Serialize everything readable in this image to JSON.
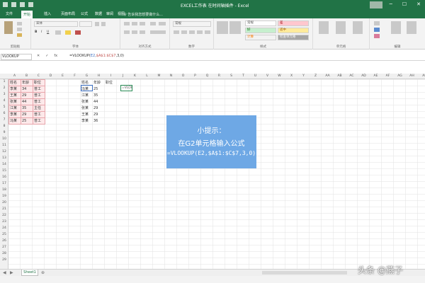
{
  "window": {
    "title": "EXCEL工作表 在时间轴插件 - Excel"
  },
  "tabs": [
    "文件",
    "开始",
    "插入",
    "页面布局",
    "公式",
    "数据",
    "审阅",
    "视图"
  ],
  "tell_me": "♀ 告诉我您想要做什么...",
  "ribbon": {
    "groups": [
      "剪贴板",
      "字体",
      "对齐方式",
      "数字",
      "样式",
      "单元格",
      "编辑"
    ],
    "font_name": "宋体",
    "number_format": "常规",
    "styles": [
      "常规",
      "差",
      "好",
      "适中",
      "计算",
      "检查单元格"
    ]
  },
  "formula_bar": {
    "name_box": "VLOOKUP",
    "buttons": [
      "✕",
      "✓",
      "fx"
    ],
    "prefix": "=VLOOKUP(",
    "ref1": "E2",
    "sep": ",",
    "ref2": "$A$1:$C$7",
    "suffix": ",3,0)"
  },
  "columns": [
    "A",
    "B",
    "C",
    "D",
    "E",
    "F",
    "G",
    "H",
    "I",
    "J",
    "K",
    "L",
    "M",
    "N",
    "O",
    "P",
    "Q",
    "R",
    "S",
    "T",
    "U",
    "V",
    "W",
    "X",
    "Y",
    "Z",
    "AA",
    "AB",
    "AC",
    "AD",
    "AE",
    "AF",
    "AG",
    "AH",
    "AI"
  ],
  "rows": [
    "1",
    "2",
    "3",
    "4",
    "5",
    "6",
    "7",
    "8",
    "9",
    "10",
    "11",
    "12",
    "13",
    "14",
    "15",
    "16",
    "17",
    "18",
    "19",
    "20",
    "21",
    "22",
    "23",
    "24",
    "25",
    "26",
    "27",
    "28",
    "29"
  ],
  "table1": [
    [
      "姓名",
      "年龄",
      "职位"
    ],
    [
      "李某",
      "34",
      "普工"
    ],
    [
      "王某",
      "29",
      "普工"
    ],
    [
      "张某",
      "44",
      "普工"
    ],
    [
      "江某",
      "35",
      "主任"
    ],
    [
      "李某",
      "29",
      "普工"
    ],
    [
      "冯某",
      "25",
      "普工"
    ]
  ],
  "table2": [
    [
      "姓名",
      "年龄",
      "职位"
    ],
    [
      "冯某",
      "25",
      ""
    ],
    [
      "江某",
      "35",
      ""
    ],
    [
      "张某",
      "44",
      ""
    ],
    [
      "张某",
      "29",
      ""
    ],
    [
      "王某",
      "29",
      ""
    ],
    [
      "李某",
      "36",
      ""
    ]
  ],
  "lookup_cell": "=VLOOKUP(",
  "tip": {
    "line1": "小提示：",
    "line2": "在G2单元格输入公式",
    "line3": "=VLOOKUP(E2,$A$1:$C$7,3,0)"
  },
  "sheet_tab": "Sheet1",
  "add_sheet": "⊕",
  "watermark": "头条 @燕子",
  "colors": {
    "accent": "#217346",
    "tip_bg": "#6ea8e5",
    "table1_bg": "#fde9ea",
    "table1_border": "#e7a5ab",
    "ref_blue": "#3b6fc2",
    "ref_red": "#c0504d"
  }
}
